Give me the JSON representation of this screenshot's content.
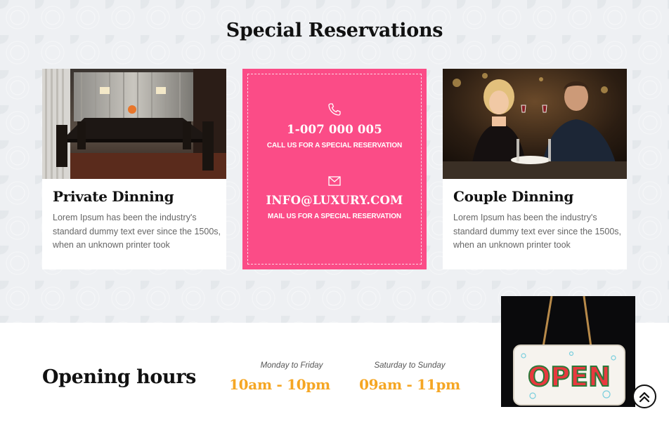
{
  "section": {
    "title": "Special Reservations"
  },
  "cards": [
    {
      "title": "Private Dinning",
      "text": "Lorem Ipsum has been the industry's standard dummy text ever since the 1500s, when an unknown printer took",
      "image": "dining-room-photo"
    },
    {
      "title": "Couple Dinning",
      "text": "Lorem Ipsum has been the industry's standard dummy text ever since the 1500s, when an unknown printer took",
      "image": "couple-toasting-photo"
    }
  ],
  "contact": {
    "phone": "1-007 000 005",
    "phone_caption": "CALL US FOR A SPECIAL RESERVATION",
    "email": "INFO@LUXURY.COM",
    "email_caption": "MAIL US FOR A SPECIAL RESERVATION",
    "phone_icon": "phone-icon",
    "email_icon": "envelope-icon",
    "accent_color": "#fb4c87"
  },
  "hours": {
    "title": "Opening hours",
    "weekday_label": "Monday to Friday",
    "weekday_time": "10am - 10pm",
    "weekend_label": "Saturday to Sunday",
    "weekend_time": "09am - 11pm",
    "time_color": "#f5a623",
    "sign_text": "OPEN"
  },
  "scroll_top": {
    "icon": "double-chevron-up-icon"
  }
}
